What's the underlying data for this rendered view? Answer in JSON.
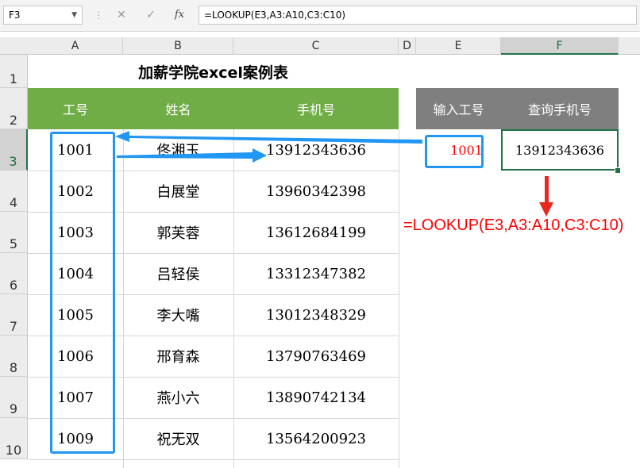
{
  "formula_bar": {
    "name_box": "F3",
    "cancel_glyph": "✕",
    "enter_glyph": "✓",
    "fx_label": "fx",
    "formula": "=LOOKUP(E3,A3:A10,C3:C10)"
  },
  "columns": [
    "A",
    "B",
    "C",
    "D",
    "E",
    "F"
  ],
  "rows": [
    "1",
    "2",
    "3",
    "4",
    "5",
    "6",
    "7",
    "8",
    "9",
    "10"
  ],
  "sheet": {
    "title": "加薪学院excel案例表",
    "headers": [
      "工号",
      "姓名",
      "手机号"
    ],
    "data": [
      {
        "id": "1001",
        "name": "佟湘玉",
        "phone": "13912343636"
      },
      {
        "id": "1002",
        "name": "白展堂",
        "phone": "13960342398"
      },
      {
        "id": "1003",
        "name": "郭芙蓉",
        "phone": "13612684199"
      },
      {
        "id": "1004",
        "name": "吕轻侯",
        "phone": "13312347382"
      },
      {
        "id": "1005",
        "name": "李大嘴",
        "phone": "13012348329"
      },
      {
        "id": "1006",
        "name": "邢育森",
        "phone": "13790763469"
      },
      {
        "id": "1007",
        "name": "燕小六",
        "phone": "13890742134"
      },
      {
        "id": "1009",
        "name": "祝无双",
        "phone": "13564200923"
      }
    ]
  },
  "lookup": {
    "input_header": "输入工号",
    "result_header": "查询手机号",
    "input_value": "1001",
    "result_value": "13912343636"
  },
  "annotation": "=LOOKUP(E3,A3:A10,C3:C10)",
  "colors": {
    "header_green": "#70ad47",
    "header_gray": "#7f7f7f",
    "highlight_blue": "#2196f3",
    "annotation_red": "#ff0000",
    "selection_green": "#217346"
  }
}
